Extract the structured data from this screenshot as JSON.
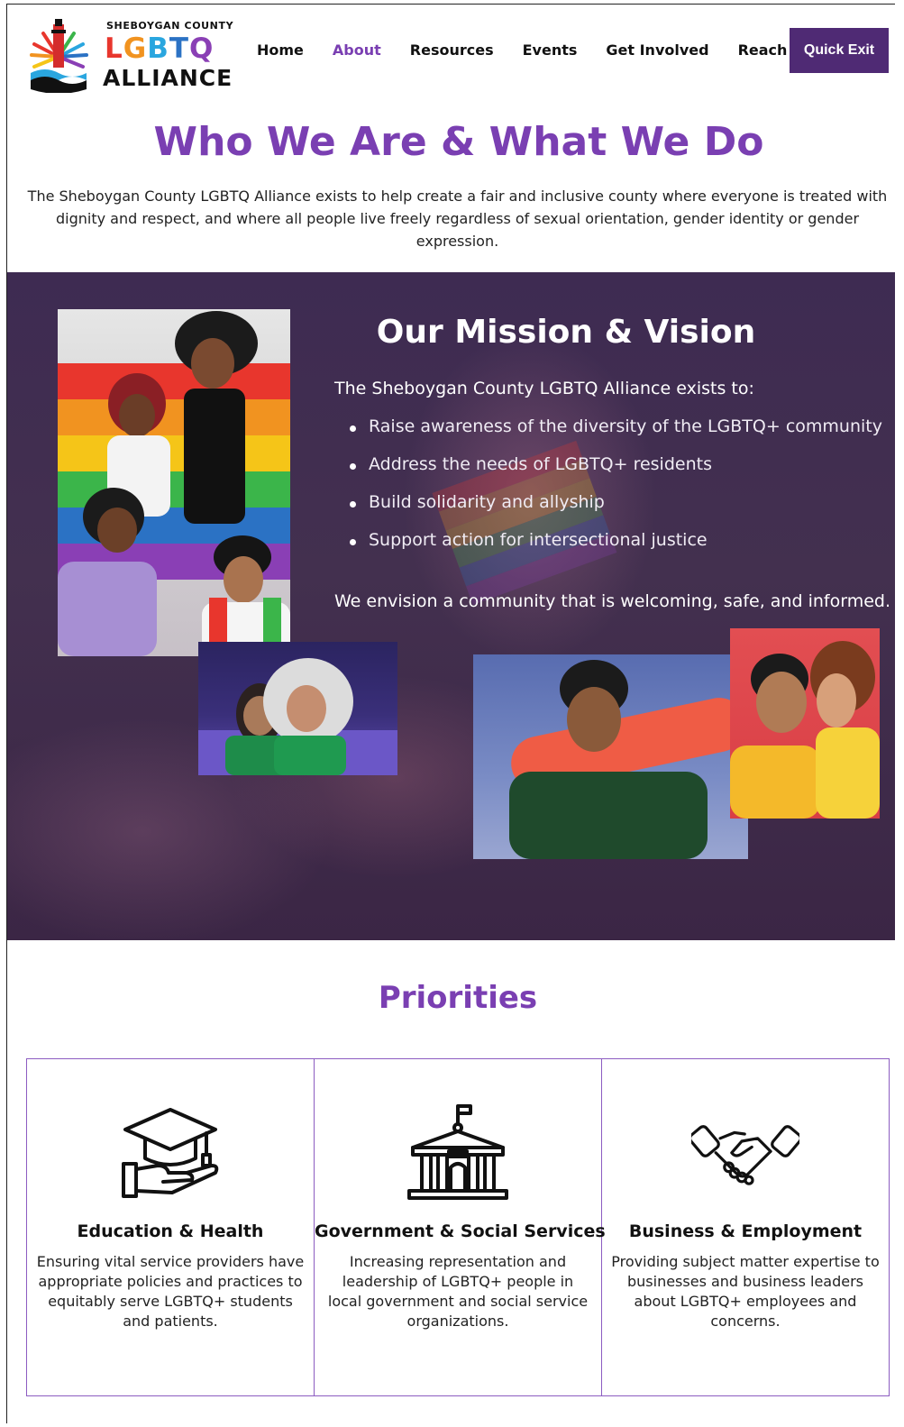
{
  "brand": {
    "top_line": "SHEBOYGAN COUNTY",
    "middle_letters": [
      "L",
      "G",
      "B",
      "T",
      "Q"
    ],
    "middle_colors": [
      "#e8362d",
      "#f19320",
      "#2aa6df",
      "#2b72c4",
      "#8a3fb5"
    ],
    "bottom_line": "ALLIANCE"
  },
  "nav": {
    "items": [
      {
        "label": "Home",
        "active": false
      },
      {
        "label": "About",
        "active": true
      },
      {
        "label": "Resources",
        "active": false
      },
      {
        "label": "Events",
        "active": false
      },
      {
        "label": "Get Involved",
        "active": false
      },
      {
        "label": "Reach Out",
        "active": false
      }
    ],
    "quick_exit": "Quick Exit"
  },
  "intro": {
    "title": "Who We Are & What We Do",
    "text": "The Sheboygan County LGBTQ Alliance exists to help create a fair and inclusive county where everyone is treated with dignity and respect, and where all people live freely regardless of sexual orientation, gender identity or gender expression."
  },
  "mission": {
    "title": "Our Mission & Vision",
    "lead": "The Sheboygan County LGBTQ Alliance exists to:",
    "items": [
      "Raise awareness of the diversity of the LGBTQ+ community",
      "Address the needs of LGBTQ+ residents",
      "Build solidarity and allyship",
      "Support action for intersectional justice"
    ],
    "vision": "We envision a community that is welcoming, safe, and informed."
  },
  "priorities": {
    "title": "Priorities",
    "cards": [
      {
        "icon": "graduation-cap-hand-icon",
        "heading": "Education & Health",
        "text": "Ensuring vital service providers have appropriate policies and practices to equitably serve LGBTQ+ students and patients."
      },
      {
        "icon": "government-building-icon",
        "heading": "Government & Social Services",
        "text": "Increasing representation and leadership of LGBTQ+ people in local government and social service organizations."
      },
      {
        "icon": "handshake-icon",
        "heading": "Business & Employment",
        "text": "Providing subject matter expertise to businesses and business leaders about LGBTQ+ employees and concerns."
      }
    ]
  },
  "colors": {
    "accent_purple": "#7a3fb2",
    "quick_exit_bg": "#4f2a74",
    "mission_bg": "#3e2b52"
  }
}
